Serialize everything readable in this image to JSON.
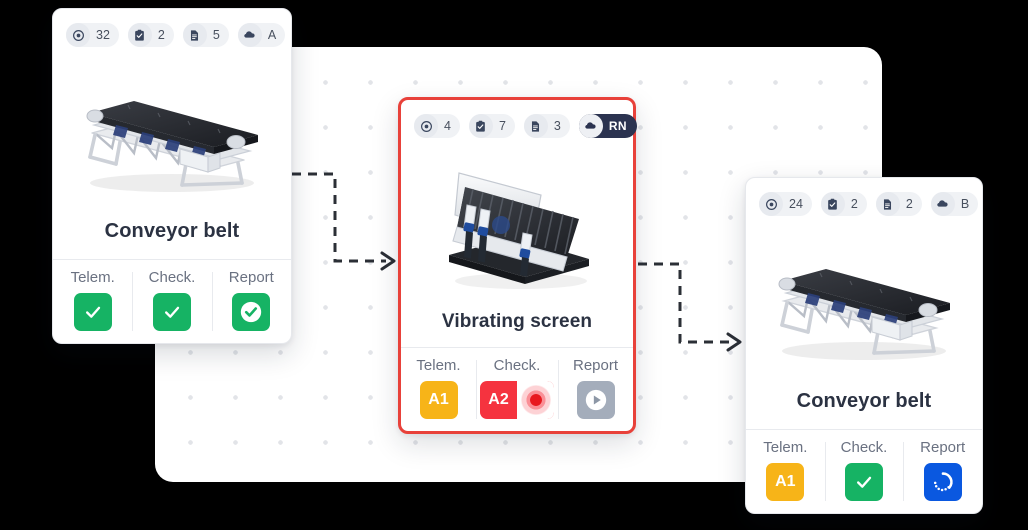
{
  "theme": {
    "accent_alert": "#e8413a",
    "accent_green": "#16b364",
    "accent_amber": "#f7b418",
    "accent_blue": "#0a58e0",
    "accent_grey": "#a4adbb",
    "accent_red": "#f5333f",
    "canvas_bg": "#ffffff",
    "page_bg": "#000000"
  },
  "canvas": {
    "name": "process-flow-canvas"
  },
  "connectors": [
    {
      "name": "connector-conveyor-to-screen",
      "style": "dashed",
      "arrow": "right"
    },
    {
      "name": "connector-screen-to-conveyor",
      "style": "dashed",
      "arrow": "right"
    }
  ],
  "footer_labels": {
    "telemetry": "Telem.",
    "checklist": "Check.",
    "report": "Report"
  },
  "cards": [
    {
      "id": "conveyor-belt-1",
      "title": "Conveyor belt",
      "state": "normal",
      "thumbnail": "conveyor-belt-render",
      "badges": [
        {
          "icon": "target-icon",
          "value": "32"
        },
        {
          "icon": "clipboard-check-icon",
          "value": "2"
        },
        {
          "icon": "document-icon",
          "value": "5"
        },
        {
          "icon": "assignee-icon",
          "value": "A",
          "variant": "light"
        }
      ],
      "footer": [
        {
          "label": "Telem.",
          "status": "check",
          "color": "green",
          "text": ""
        },
        {
          "label": "Check.",
          "status": "check",
          "color": "green",
          "text": ""
        },
        {
          "label": "Report",
          "status": "check-circle",
          "color": "green",
          "text": ""
        }
      ]
    },
    {
      "id": "vibrating-screen",
      "title": "Vibrating screen",
      "state": "alert",
      "thumbnail": "vibrating-screen-render",
      "badges": [
        {
          "icon": "target-icon",
          "value": "4"
        },
        {
          "icon": "clipboard-check-icon",
          "value": "7"
        },
        {
          "icon": "document-icon",
          "value": "3"
        },
        {
          "icon": "assignee-icon",
          "value": "RN",
          "variant": "dark"
        }
      ],
      "footer": [
        {
          "label": "Telem.",
          "status": "code",
          "color": "amber",
          "text": "A1"
        },
        {
          "label": "Check.",
          "status": "code-recording",
          "color": "red",
          "text": "A2"
        },
        {
          "label": "Report",
          "status": "play",
          "color": "grey",
          "text": ""
        }
      ]
    },
    {
      "id": "conveyor-belt-2",
      "title": "Conveyor belt",
      "state": "normal",
      "thumbnail": "conveyor-belt-render",
      "badges": [
        {
          "icon": "target-icon",
          "value": "24"
        },
        {
          "icon": "clipboard-check-icon",
          "value": "2"
        },
        {
          "icon": "document-icon",
          "value": "2"
        },
        {
          "icon": "assignee-icon",
          "value": "B",
          "variant": "light"
        }
      ],
      "footer": [
        {
          "label": "Telem.",
          "status": "code",
          "color": "amber",
          "text": "A1"
        },
        {
          "label": "Check.",
          "status": "check",
          "color": "green",
          "text": ""
        },
        {
          "label": "Report",
          "status": "loading",
          "color": "blue",
          "text": ""
        }
      ]
    }
  ]
}
